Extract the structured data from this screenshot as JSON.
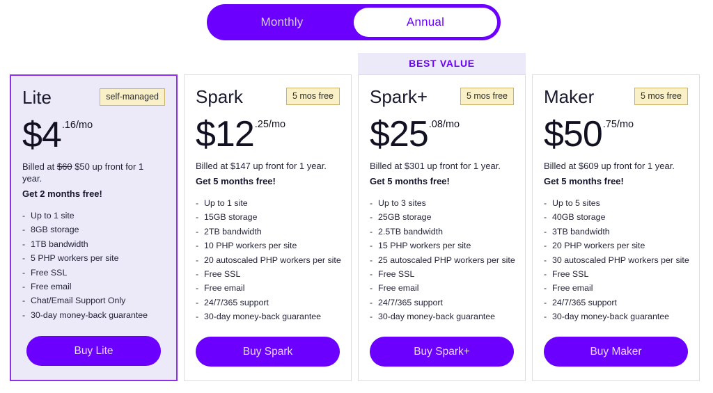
{
  "billing_toggle": {
    "options": [
      {
        "label": "Monthly",
        "active": false
      },
      {
        "label": "Annual",
        "active": true
      }
    ]
  },
  "colors": {
    "accent_purple": "#6b00ff",
    "featured_bg": "#eceaf8",
    "featured_border": "#8d30e8",
    "badge_bg": "#faf0c8",
    "badge_border": "#c9b36a",
    "banner_bg": "#eceaf8",
    "card_border": "#dddddd"
  },
  "plans": [
    {
      "banner": "",
      "featured": true,
      "name": "Lite",
      "badge": "self-managed",
      "price_main": "$4",
      "price_cents": ".16/mo",
      "billed_prefix": "Billed at ",
      "billed_old": "$60",
      "billed_new": " $50 up front for 1 year.",
      "free_line": "Get 2 months free!",
      "features": [
        "Up to 1 site",
        "8GB storage",
        "1TB bandwidth",
        "5 PHP workers per site",
        "Free SSL",
        "Free email",
        "Chat/Email Support Only",
        "30-day money-back guarantee"
      ],
      "cta": "Buy Lite"
    },
    {
      "banner": "",
      "featured": false,
      "name": "Spark",
      "badge": "5 mos free",
      "price_main": "$12",
      "price_cents": ".25/mo",
      "billed_prefix": "Billed at ",
      "billed_old": "",
      "billed_new": "$147 up front for 1 year.",
      "free_line": "Get 5 months free!",
      "features": [
        "Up to 1 site",
        "15GB storage",
        "2TB bandwidth",
        "10 PHP workers per site",
        "20 autoscaled PHP workers per site",
        "Free SSL",
        "Free email",
        "24/7/365 support",
        "30-day money-back guarantee"
      ],
      "cta": "Buy Spark"
    },
    {
      "banner": "BEST VALUE",
      "featured": false,
      "name": "Spark+",
      "badge": "5 mos free",
      "price_main": "$25",
      "price_cents": ".08/mo",
      "billed_prefix": "Billed at ",
      "billed_old": "",
      "billed_new": "$301 up front for 1 year.",
      "free_line": "Get 5 months free!",
      "features": [
        "Up to 3 sites",
        "25GB storage",
        "2.5TB bandwidth",
        "15 PHP workers per site",
        "25 autoscaled PHP workers per site",
        "Free SSL",
        "Free email",
        "24/7/365 support",
        "30-day money-back guarantee"
      ],
      "cta": "Buy Spark+"
    },
    {
      "banner": "",
      "featured": false,
      "name": "Maker",
      "badge": "5 mos free",
      "price_main": "$50",
      "price_cents": ".75/mo",
      "billed_prefix": "Billed at ",
      "billed_old": "",
      "billed_new": "$609 up front for 1 year.",
      "free_line": "Get 5 months free!",
      "features": [
        "Up to 5 sites",
        "40GB storage",
        "3TB bandwidth",
        "20 PHP workers per site",
        "30 autoscaled PHP workers per site",
        "Free SSL",
        "Free email",
        "24/7/365 support",
        "30-day money-back guarantee"
      ],
      "cta": "Buy Maker"
    }
  ]
}
